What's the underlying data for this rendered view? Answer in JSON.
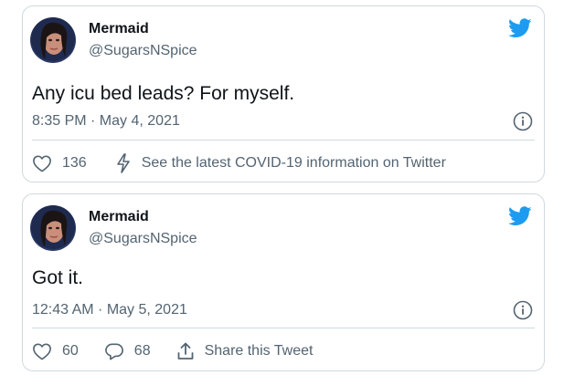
{
  "colors": {
    "brand": "#1d9bf0",
    "text": "#0f1419",
    "secondary": "#536471",
    "border": "#cfd9de"
  },
  "tweets": [
    {
      "name": "Mermaid",
      "handle": "@SugarsNSpice",
      "text": "Any icu bed leads? For myself.",
      "timestamp": "8:35 PM · May 4, 2021",
      "likes": "136",
      "covid_link": "See the latest COVID-19 information on Twitter",
      "icons": [
        "avatar",
        "twitter-bird-icon",
        "info-icon",
        "heart-icon",
        "lightning-icon"
      ]
    },
    {
      "name": "Mermaid",
      "handle": "@SugarsNSpice",
      "text": "Got it.",
      "timestamp": "12:43 AM · May 5, 2021",
      "likes": "60",
      "replies": "68",
      "share_label": "Share this Tweet",
      "icons": [
        "avatar",
        "twitter-bird-icon",
        "info-icon",
        "heart-icon",
        "reply-icon",
        "share-icon"
      ]
    }
  ]
}
